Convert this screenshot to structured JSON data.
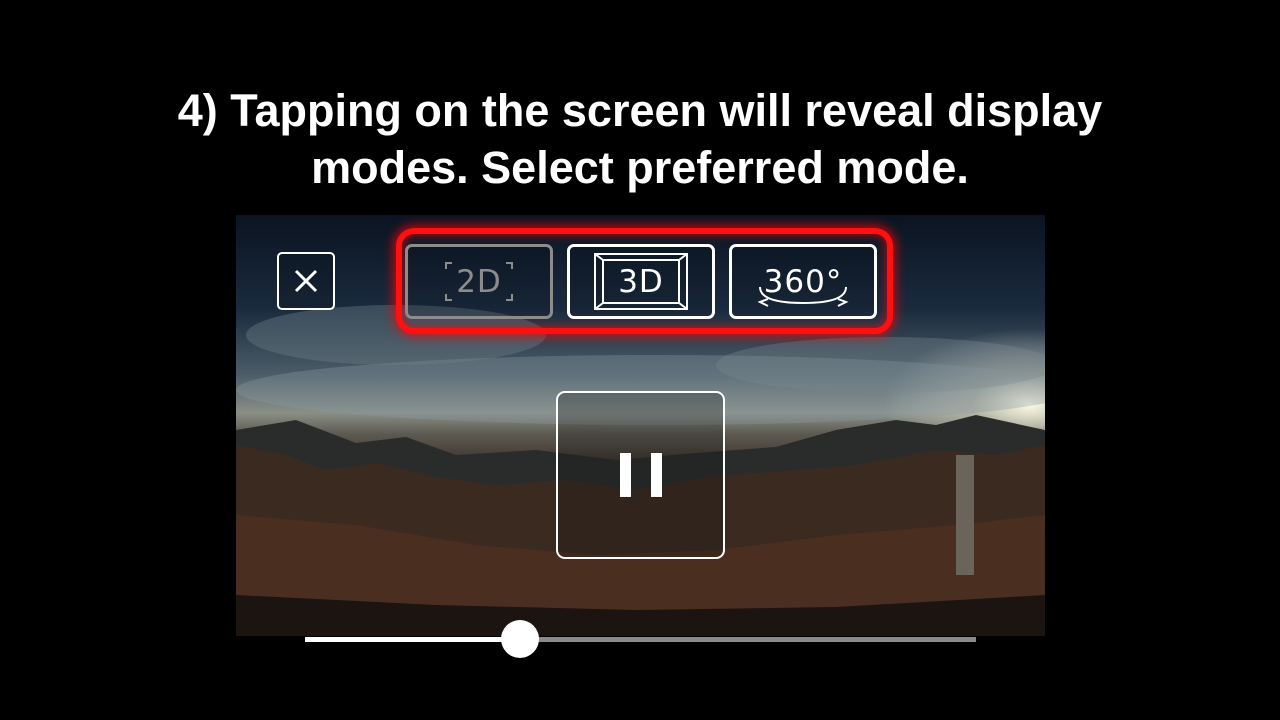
{
  "caption": {
    "line1": "4) Tapping on the screen will reveal display",
    "line2": "modes. Select preferred mode."
  },
  "player": {
    "close_icon": "close-icon",
    "modes": [
      {
        "label": "2D",
        "state": "disabled",
        "icon": "2d-frame-icon"
      },
      {
        "label": "3D",
        "state": "enabled",
        "icon": "3d-frame-icon"
      },
      {
        "label": "360°",
        "state": "enabled",
        "icon": "360-rotate-icon"
      }
    ],
    "highlight_color": "#ff1010",
    "pause_icon": "pause-icon",
    "progress": 0.32
  }
}
